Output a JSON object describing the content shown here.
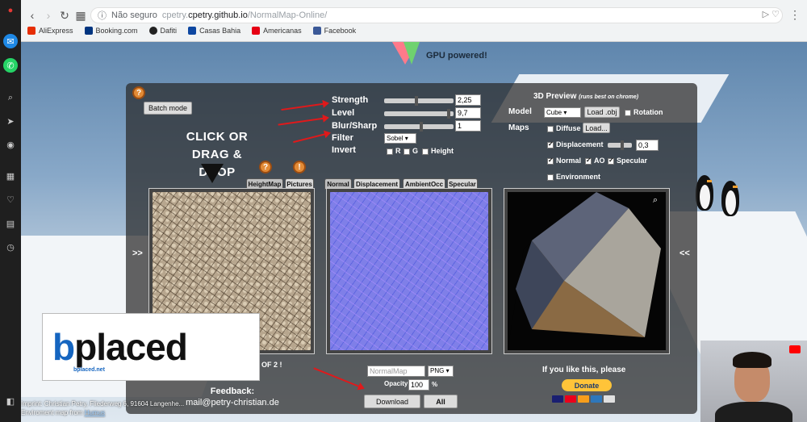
{
  "browser": {
    "security_label": "Não seguro",
    "url_host": "cpetry.github.io",
    "url_path": "/NormalMap-Online/",
    "bookmarks": [
      "AliExpress",
      "Booking.com",
      "Dafiti",
      "Casas Bahia",
      "Americanas",
      "Facebook"
    ],
    "icons": [
      "back-icon",
      "forward-icon",
      "reload-icon",
      "apps-icon",
      "play-icon",
      "star-icon",
      "menu-icon"
    ]
  },
  "header": {
    "gpu_label": "GPU powered!"
  },
  "panel": {
    "batch_button": "Batch mode",
    "drop_text_1": "CLICK OR",
    "drop_text_2": "DRAG & DROP",
    "strength_label": "Strength",
    "strength_value": "2,25",
    "level_label": "Level",
    "level_value": "9,7",
    "blur_label": "Blur/Sharp",
    "blur_value": "1",
    "filter_label": "Filter",
    "filter_value": "Sobel",
    "invert_label": "Invert",
    "invert_r": "R",
    "invert_g": "G",
    "invert_height": "Height",
    "tabs_left": [
      "HeightMap",
      "Pictures"
    ],
    "tabs_mid": [
      "Normal",
      "Displacement",
      "AmbientOcc",
      "Specular"
    ],
    "preview_title": "3D Preview",
    "preview_note": "(runs best on chrome)",
    "model_label": "Model",
    "model_value": "Cube",
    "load_obj": "Load .obj",
    "rotation": "Rotation",
    "maps_label": "Maps",
    "diffuse": "Diffuse",
    "load_btn": "Load...",
    "displacement": "Displacement",
    "displacement_value": "0,3",
    "normal": "Normal",
    "ao": "AO",
    "specular": "Specular",
    "environment": "Environment",
    "arrow_left": ">>",
    "arrow_right": "<<",
    "size_text": "Size: 640 x 640 NOT POWER OF 2 !",
    "feedback_title": "Feedback:",
    "feedback_email": "mail@petry-christian.de",
    "filename_placeholder": "NormalMap",
    "format_value": "PNG",
    "opacity_label": "Opacity",
    "opacity_value": "100",
    "percent": "%",
    "download": "Download",
    "all": "All",
    "like_text": "If you like this, please",
    "donate": "Donate"
  },
  "footer": {
    "imprint": "Imprint: Christian Petry, Fliederweg 6, 91604 Langenhe...",
    "env_map": "Enviroment map from ",
    "env_link": "Humus"
  },
  "ad": {
    "logo_b": "b",
    "logo_rest": "placed",
    "sub": "bplaced.net"
  },
  "colors": {
    "accent_red": "#e0191b",
    "donate_yellow": "#ffc439",
    "normal_blue": "#7f7fe8"
  }
}
